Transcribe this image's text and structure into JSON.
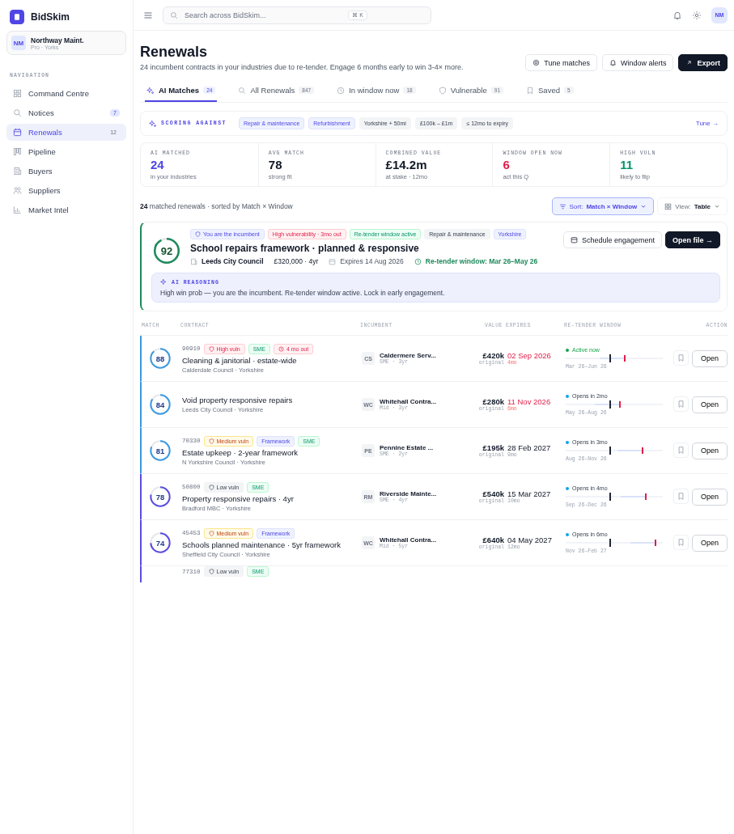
{
  "brand": {
    "name": "BidSkim"
  },
  "account": {
    "initials": "NM",
    "name": "Northway Maint.",
    "plan": "Pro · Yorks"
  },
  "sidebar": {
    "heading": "NAVIGATION",
    "items": [
      {
        "label": "Command Centre",
        "selected": false
      },
      {
        "label": "Notices",
        "count": "7",
        "selected": false
      },
      {
        "label": "Renewals",
        "count": "12",
        "selected": true
      },
      {
        "label": "Pipeline",
        "selected": false
      },
      {
        "label": "Buyers",
        "selected": false
      },
      {
        "label": "Suppliers",
        "selected": false
      },
      {
        "label": "Market Intel",
        "selected": false
      }
    ]
  },
  "topbar": {
    "search_placeholder": "Search across BidSkim...",
    "shortcut": "⌘ K",
    "avatar": "NM"
  },
  "page": {
    "title": "Renewals",
    "subtitle": "24 incumbent contracts in your industries due to re-tender. Engage 6 months early to win 3-4× more.",
    "actions": [
      "Tune matches",
      "Window alerts",
      "Export"
    ]
  },
  "tabs": [
    {
      "label": "AI Matches",
      "count": "24",
      "selected": true
    },
    {
      "label": "All Renewals",
      "count": "847",
      "selected": false
    },
    {
      "label": "In window now",
      "count": "18",
      "selected": false
    },
    {
      "label": "Vulnerable",
      "count": "91",
      "selected": false
    },
    {
      "label": "Saved",
      "count": "5",
      "selected": false
    }
  ],
  "scoring": {
    "label": "SCORING AGAINST",
    "chips": [
      {
        "label": "Repair & maintenance",
        "kind": "industry"
      },
      {
        "label": "Refurbishment",
        "kind": "industry"
      },
      {
        "label": "Yorkshire + 50mi",
        "kind": "filter"
      },
      {
        "label": "£100k – £1m",
        "kind": "filter"
      },
      {
        "label": "≤ 12mo to expiry",
        "kind": "filter"
      }
    ],
    "link": "Tune →"
  },
  "stats": [
    {
      "label": "AI MATCHED",
      "value": "24",
      "note": "in your industries",
      "color": "#4f46e5"
    },
    {
      "label": "AVG MATCH",
      "value": "78",
      "note": "strong fit",
      "color": "#111827"
    },
    {
      "label": "COMBINED VALUE",
      "value": "£14.2m",
      "note": "at stake · 12mo",
      "color": "#111827"
    },
    {
      "label": "WINDOW OPEN NOW",
      "value": "6",
      "note": "act this Q",
      "color": "#e11d48"
    },
    {
      "label": "HIGH VULN",
      "value": "11",
      "note": "likely to flip",
      "color": "#059669"
    }
  ],
  "summary": {
    "count": "24",
    "text": "matched renewals · sorted by Match × Window",
    "sort_label": "Sort:",
    "sort_value": "Match × Window",
    "view_label": "View:",
    "view_value": "Table"
  },
  "featured": {
    "score": "92",
    "tags": [
      {
        "label": "You are the incumbent",
        "kind": "incumbent"
      },
      {
        "label": "High vulnerability · 3mo out",
        "kind": "high"
      },
      {
        "label": "Re-tender window active",
        "kind": "active"
      },
      {
        "label": "Repair & maintenance",
        "kind": "neutral"
      },
      {
        "label": "Yorkshire",
        "kind": "region"
      }
    ],
    "title": "School repairs framework · planned & responsive",
    "buyer": "Leeds City Council",
    "value": "£320,000 · 4yr",
    "expires": "Expires 14 Aug 2026",
    "window": "Re-tender window: Mar 26–May 26",
    "actions": [
      "Schedule engagement",
      "Open file →"
    ],
    "reasoning_label": "AI REASONING",
    "reasoning": "High win prob — you are the incumbent. Re-tender window active. Lock in early engagement."
  },
  "table": {
    "columns": [
      "MATCH",
      "CONTRACT",
      "INCUMBENT",
      "VALUE",
      "EXPIRES",
      "RE-TENDER WINDOW",
      "ACTION"
    ],
    "rows": [
      {
        "kind": "full",
        "score": "88",
        "color": "#3b9ae1",
        "id": "90910",
        "tags": [
          {
            "label": "High vuln",
            "kind": "high"
          },
          {
            "label": "SME",
            "kind": "sme"
          },
          {
            "label": "4 mo out",
            "kind": "out"
          }
        ],
        "title": "Cleaning & janitorial · estate-wide",
        "buyer": "Calderdale Council · Yorkshire",
        "inc_initials": "CS",
        "inc_name": "Caldermere Serv...",
        "inc_meta": "SME · 3yr",
        "value": "£420k",
        "value_note": "original",
        "expires": "02 Sep 2026",
        "expires_in": "4mo",
        "urgent": true,
        "status": {
          "label": "Active now",
          "color": "#16a34a"
        },
        "window": "Mar 26–Jun 26",
        "timeline": {
          "level": 0.6
        },
        "action": "Open"
      },
      {
        "kind": "full",
        "score": "84",
        "color": "#3b9ae1",
        "title": "Void property responsive repairs",
        "buyer": "Leeds City Council · Yorkshire",
        "inc_initials": "WC",
        "inc_name": "Whitehall Contra...",
        "inc_meta": "Mid · 3yr",
        "value": "£280k",
        "value_note": "original",
        "expires": "11 Nov 2026",
        "expires_in": "6mo",
        "urgent": true,
        "status": {
          "label": "Opens in 2mo",
          "color": "#0ea5e9"
        },
        "window": "May 26–Aug 26",
        "timeline": {
          "level": 0.55
        },
        "action": "Open"
      },
      {
        "kind": "full",
        "score": "81",
        "color": "#3b9ae1",
        "id": "70330",
        "tags": [
          {
            "label": "Medium vuln",
            "kind": "medium"
          },
          {
            "label": "Framework",
            "kind": "framework"
          },
          {
            "label": "SME",
            "kind": "sme"
          }
        ],
        "title": "Estate upkeep · 2-year framework",
        "buyer": "N Yorkshire Council · Yorkshire",
        "inc_initials": "PE",
        "inc_name": "Pennine Estate ...",
        "inc_meta": "SME · 2yr",
        "value": "£195k",
        "value_note": "original",
        "expires": "28 Feb 2027",
        "expires_in": "9mo",
        "urgent": false,
        "status": {
          "label": "Opens in 3mo",
          "color": "#0ea5e9"
        },
        "window": "Aug 26–Nov 26",
        "timeline": {
          "level": 0.78
        },
        "action": "Open"
      },
      {
        "kind": "full",
        "score": "78",
        "color": "#5b4de0",
        "id": "50800",
        "tags": [
          {
            "label": "Low vuln",
            "kind": "low"
          },
          {
            "label": "SME",
            "kind": "sme"
          }
        ],
        "title": "Property responsive repairs · 4yr",
        "buyer": "Bradford MBC · Yorkshire",
        "inc_initials": "RM",
        "inc_name": "Riverside Mainte...",
        "inc_meta": "SME · 4yr",
        "value": "£540k",
        "value_note": "original",
        "expires": "15 Mar 2027",
        "expires_in": "10mo",
        "urgent": false,
        "status": {
          "label": "Opens in 4mo",
          "color": "#0ea5e9"
        },
        "window": "Sep 26–Dec 26",
        "timeline": {
          "level": 0.82
        },
        "action": "Open"
      },
      {
        "kind": "full",
        "score": "74",
        "color": "#5b4de0",
        "id": "45453",
        "tags": [
          {
            "label": "Medium vuln",
            "kind": "medium"
          },
          {
            "label": "Framework",
            "kind": "framework"
          }
        ],
        "title": "Schools planned maintenance · 5yr framework",
        "buyer": "Sheffield City Council · Yorkshire",
        "inc_initials": "WC",
        "inc_name": "Whitehall Contra...",
        "inc_meta": "Mid · 5yr",
        "value": "£640k",
        "value_note": "original",
        "expires": "04 May 2027",
        "expires_in": "12mo",
        "urgent": false,
        "status": {
          "label": "Opens in 6mo",
          "color": "#0ea5e9"
        },
        "window": "Nov 26–Feb 27",
        "timeline": {
          "level": 0.92
        },
        "action": "Open"
      },
      {
        "kind": "partial",
        "id": "77310",
        "tags": [
          {
            "label": "Low vuln",
            "kind": "low"
          },
          {
            "label": "SME",
            "kind": "sme"
          }
        ]
      }
    ]
  }
}
